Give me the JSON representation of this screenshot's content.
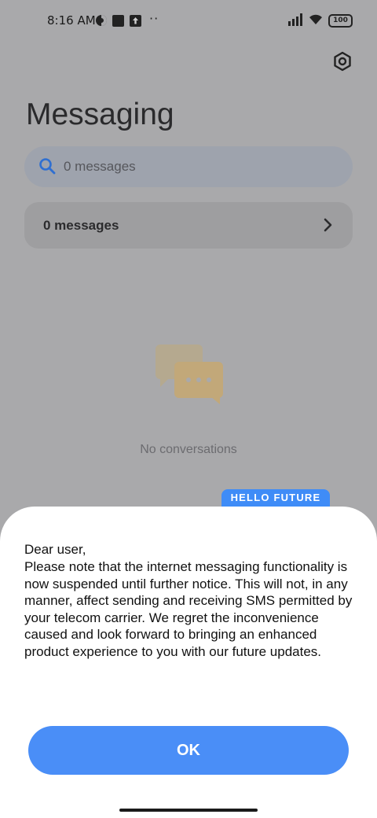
{
  "status_bar": {
    "time": "8:16 AM",
    "dots": "··",
    "battery": "100",
    "icons": [
      "theme-icon",
      "notification-square-icon",
      "upload-icon",
      "signal-icon",
      "wifi-icon",
      "battery-icon"
    ]
  },
  "header": {
    "title": "Messaging",
    "settings_icon": "settings-hex-icon"
  },
  "search": {
    "placeholder": "0 messages",
    "icon": "search-icon"
  },
  "messages_row": {
    "label": "0 messages",
    "icon": "chevron-right-icon"
  },
  "empty_state": {
    "text": "No conversations",
    "icon": "chat-bubbles-icon"
  },
  "badge": {
    "text": "HELLO  FUTURE"
  },
  "dialog": {
    "greeting": "Dear user,",
    "body": "Please note that the internet messaging functionality is now suspended until further notice. This will not, in any manner, affect sending and receiving SMS permitted by your telecom carrier. We regret the inconvenience caused and look forward to bringing an enhanced product experience to you with our future updates.",
    "ok_label": "OK"
  },
  "colors": {
    "accent": "#4a8ef7",
    "overlay": "#a9a9ab",
    "dialog_bg": "#ffffff"
  }
}
